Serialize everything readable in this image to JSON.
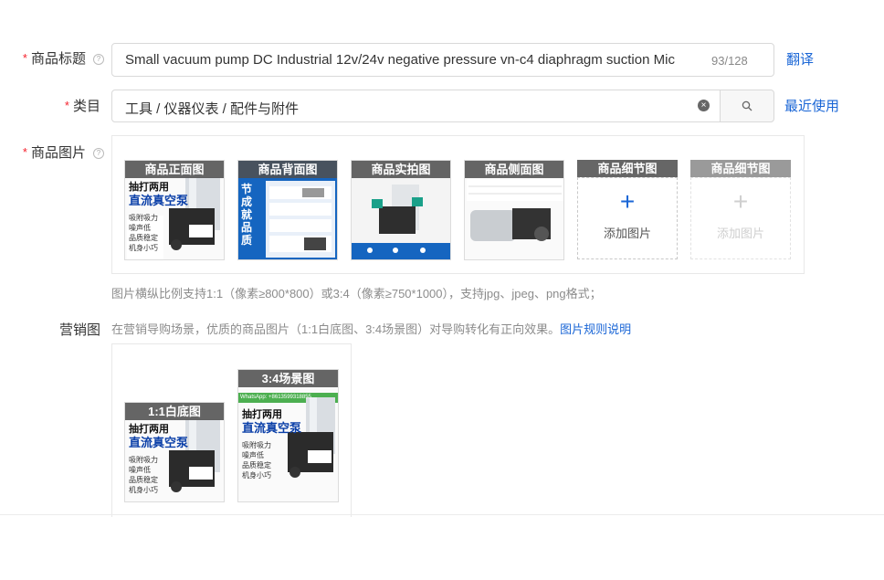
{
  "form": {
    "title_field": {
      "label": "商品标题",
      "value": "Small vacuum pump DC Industrial 12v/24v negative pressure  vn-c4 diaphragm suction  Mic",
      "counter": "93/128",
      "translate_link": "翻译"
    },
    "category_field": {
      "label": "类目",
      "value": "工具 / 仪器仪表 / 配件与附件",
      "recent_link": "最近使用"
    },
    "images_field": {
      "label": "商品图片",
      "thumbnails": [
        {
          "tag": "商品正面图",
          "lines": [
            "抽打两用",
            "直流真空泵"
          ],
          "bullets": [
            "吸附吸力",
            "噪声低",
            "品质稳定",
            "机身小巧"
          ]
        },
        {
          "tag": "商品背面图",
          "lines": [
            "节",
            "成",
            "就",
            "品",
            "质"
          ]
        },
        {
          "tag": "商品实拍图"
        },
        {
          "tag": "商品侧面图"
        }
      ],
      "placeholders": [
        {
          "tag": "商品细节图",
          "text": "添加图片",
          "icon": "plus-icon"
        },
        {
          "tag": "商品细节图",
          "text": "添加图片",
          "icon": "plus-icon"
        }
      ],
      "hint": "图片横纵比例支持1:1（像素≥800*800）或3:4（像素≥750*1000），支持jpg、jpeg、png格式；"
    },
    "marketing_field": {
      "label": "营销图",
      "description": "在营销导购场景，优质的商品图片（1:1白底图、3:4场景图）对导购转化有正向效果。",
      "rules_link": "图片规则说明",
      "images": [
        {
          "tag": "1:1白底图",
          "lines": [
            "抽打两用",
            "直流真空泵"
          ],
          "bullets": [
            "吸附吸力",
            "噪声低",
            "品质稳定",
            "机身小巧"
          ]
        },
        {
          "tag": "3:4场景图",
          "top_strip": "WhatsApp: +8613599318855",
          "lines": [
            "抽打两用",
            "直流真空泵"
          ],
          "bullets": [
            "吸附吸力",
            "噪声低",
            "品质稳定",
            "机身小巧"
          ]
        }
      ]
    }
  },
  "colors": {
    "accent": "#1a66d6",
    "required": "#f5222d",
    "tag_bg": "#5a5a5a"
  }
}
